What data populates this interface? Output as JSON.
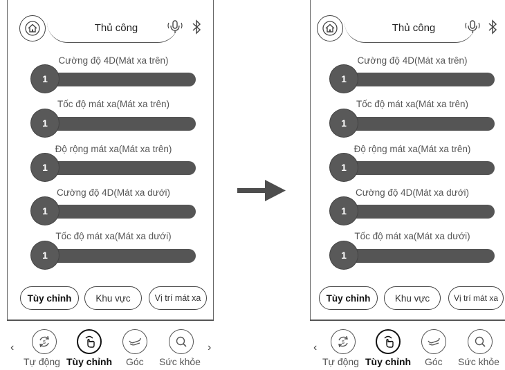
{
  "header": {
    "title": "Thủ công"
  },
  "sliders": [
    {
      "label": "Cường độ 4D(Mát xa trên)",
      "value": "1"
    },
    {
      "label": "Tốc độ mát xa(Mát xa trên)",
      "value": "1"
    },
    {
      "label": "Độ rộng mát xa(Mát xa trên)",
      "value": "1"
    },
    {
      "label": "Cường độ 4D(Mát xa dưới)",
      "value": "1"
    },
    {
      "label": "Tốc độ mát xa(Mát xa dưới)",
      "value": "1"
    }
  ],
  "mode_buttons": [
    "Tùy chỉnh",
    "Khu vực",
    "Vị trí mát xa"
  ],
  "bottom_nav": [
    "Tự động",
    "Tùy chỉnh",
    "Góc",
    "Sức khỏe"
  ],
  "colors": {
    "slider": "#555555",
    "outline": "#444444",
    "arrow": "#4d4d4d"
  }
}
